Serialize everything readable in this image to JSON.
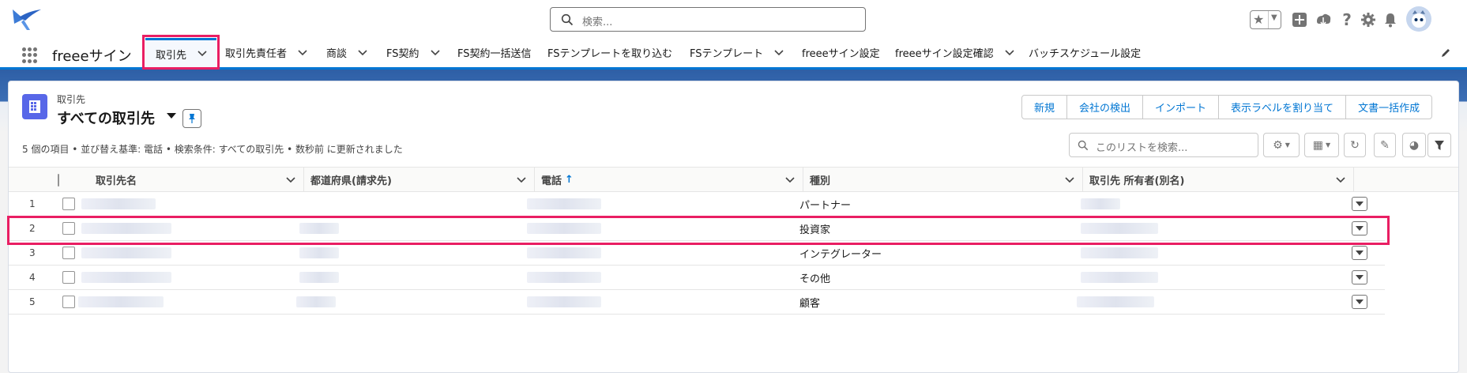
{
  "header": {
    "search_placeholder": "検索...",
    "icons": [
      "favorites-star-icon",
      "add-icon",
      "trailhead-icon",
      "help-icon",
      "setup-gear-icon",
      "notification-bell-icon",
      "user-avatar"
    ]
  },
  "nav": {
    "app_name": "freeeサイン",
    "items": [
      {
        "label": "取引先",
        "active": true
      },
      {
        "label": "取引先責任者"
      },
      {
        "label": "商談"
      },
      {
        "label": "FS契約"
      },
      {
        "label": "FS契約一括送信"
      },
      {
        "label": "FSテンプレートを取り込む"
      },
      {
        "label": "FSテンプレート"
      },
      {
        "label": "freeeサイン設定"
      },
      {
        "label": "freeeサイン設定確認"
      },
      {
        "label": "バッチスケジュール設定"
      }
    ]
  },
  "list": {
    "object_label": "取引先",
    "title": "すべての取引先",
    "buttons": [
      "新規",
      "会社の検出",
      "インポート",
      "表示ラベルを割り当て",
      "文書一括作成"
    ],
    "meta": "5 個の項目 • 並び替え基準: 電話 • 検索条件: すべての取引先 • 数秒前 に更新されました",
    "search_placeholder": "このリストを検索..."
  },
  "table": {
    "columns": [
      "取引先名",
      "都道府県(請求先)",
      "電話",
      "種別",
      "取引先 所有者(別名)"
    ],
    "sorted_column": "電話",
    "rows": [
      {
        "num": "1",
        "type": "パートナー"
      },
      {
        "num": "2",
        "type": "投資家",
        "highlighted": true
      },
      {
        "num": "3",
        "type": "インテグレーター"
      },
      {
        "num": "4",
        "type": "その他"
      },
      {
        "num": "5",
        "type": "顧客"
      }
    ]
  },
  "colors": {
    "accent": "#0176d3",
    "highlight": "#e91e63",
    "object_icon": "#5867e8"
  }
}
